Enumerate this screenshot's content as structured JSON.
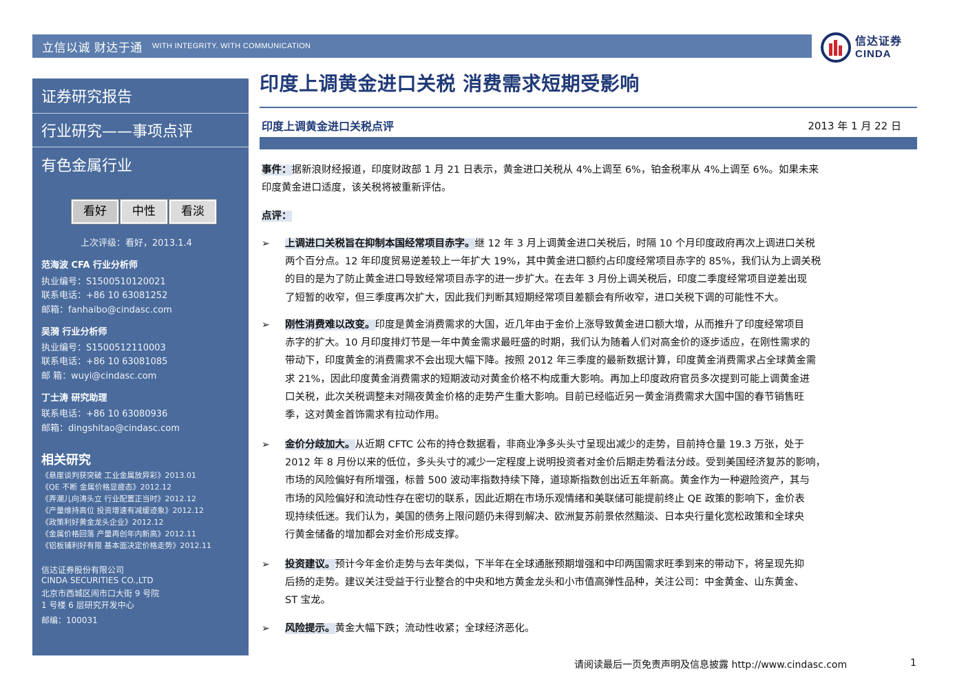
{
  "header": {
    "slogan_cn": "立信以诚  财达于通",
    "slogan_en": "WITH INTEGRITY. WITH COMMUNICATION",
    "logo_cn": "信达证券",
    "logo_en": "CINDA"
  },
  "sidebar": {
    "heads": [
      "证券研究报告",
      "行业研究——事项点评",
      "有色金属行业"
    ],
    "ratings": [
      "看好",
      "中性",
      "看淡"
    ],
    "last_rating": "上次评级：看好，2013.1.4",
    "analysts": [
      {
        "name": "范海波 CFA   行业分析师",
        "lines": [
          "执业编号：S1500510120021",
          "联系电话：+86 10 63081252",
          "邮箱：fanhaibo@cindasc.com"
        ]
      },
      {
        "name": "吴漪   行业分析师",
        "lines": [
          "执业编号：S1500512110003",
          "联系电话：+86 10 63081085",
          "邮    箱：wuyi@cindasc.com"
        ]
      },
      {
        "name": "丁士涛  研究助理",
        "lines": [
          "联系电话：+86 10 63080936",
          "邮箱：dingshitao@cindasc.com"
        ]
      }
    ],
    "related_title": "相关研究",
    "related": [
      "《悬崖谈判获突破 工业金属放异彩》2013.01",
      "《QE 不断 金属价格显疲态》2012.12",
      "《弄潮儿向涛头立 行业配置正当时》2012.12",
      "《产量维持高位 投资增速有减缓迹象》2012.12",
      "《政策利好黄金龙头企业》2012.12",
      "《金属价格回落 产量再创年内新高》2012.11",
      "《铝板铺利好有限 基本面决定价格走势》2012.11"
    ],
    "company": [
      "信达证券股份有限公司",
      "CINDA SECURITIES CO.,LTD",
      "北京市西城区闹市口大街 9 号院",
      "1 号楼 6 层研究开发中心",
      "邮编：100031"
    ]
  },
  "main": {
    "title": "印度上调黄金进口关税  消费需求短期受影响",
    "subtitle": "印度上调黄金进口关税点评",
    "date": "2013 年 1 月 22 日",
    "event_label": "事件：",
    "event_lines": [
      "据新浪财经报道，印度财政部 1 月 21 日表示，黄金进口关税从 4%上调至 6%，铂金税率从 4%上调至 6%。如果未来",
      "印度黄金进口适度，该关税将被重新评估。"
    ],
    "review_label": "点评：",
    "bullet_glyph": "➢",
    "bullets": [
      {
        "title": "上调进口关税旨在抑制本国经常项目赤字。",
        "lines": [
          "继 12 年 3 月上调黄金进口关税后，时隔 10 个月印度政府再次上调进口关税",
          "两个百分点。12 年印度贸易逆差较上一年扩大 19%，其中黄金进口额约占印度经常项目赤字的 85%，我们认为上调关税",
          "的目的是为了防止黄金进口导致经常项目赤字的进一步扩大。在去年 3 月份上调关税后，印度二季度经常项目逆差出现",
          "了短暂的收窄，但三季度再次扩大，因此我们判断其短期经常项目差额会有所收窄，进口关税下调的可能性不大。"
        ]
      },
      {
        "title": "刚性消费难以改变。",
        "lines": [
          "印度是黄金消费需求的大国，近几年由于金价上涨导致黄金进口额大增，从而推升了印度经常项目",
          "赤字的扩大。10 月印度排灯节是一年中黄金需求最旺盛的时期，我们认为随着人们对高金价的逐步适应，在刚性需求的",
          "带动下，印度黄金的消费需求不会出现大幅下降。按照 2012 年三季度的最新数据计算，印度黄金消费需求占全球黄金需",
          "求 21%，因此印度黄金消费需求的短期波动对黄金价格不构成重大影响。再加上印度政府官员多次提到可能上调黄金进",
          "口关税，此次关税调整未对隔夜黄金价格的走势产生重大影响。目前已经临近另一黄金消费需求大国中国的春节销售旺",
          "季，这对黄金首饰需求有拉动作用。"
        ]
      },
      {
        "title": "金价分歧加大。",
        "lines": [
          "从近期 CFTC 公布的持仓数据看，非商业净多头头寸呈现出减少的走势，目前持仓量 19.3 万张，处于",
          "2012 年 8 月份以来的低位，多头头寸的减少一定程度上说明投资者对金价后期走势看法分歧。受到美国经济复苏的影响，",
          "市场的风险偏好有所增强，标普 500 波动率指数持续下降，道琼斯指数创出近五年新高。黄金作为一种避险资产，其与",
          "市场的风险偏好和流动性存在密切的联系，因此近期在市场乐观情绪和美联储可能提前终止 QE 政策的影响下，金价表",
          "现持续低迷。我们认为，美国的债务上限问题仍未得到解决、欧洲复苏前景依然黯淡、日本央行量化宽松政策和全球央",
          "行黄金储备的增加都会对金价形成支撑。"
        ]
      },
      {
        "title": "投资建议。",
        "lines": [
          "预计今年金价走势与去年类似，下半年在全球通胀预期增强和中印两国需求旺季到来的带动下，将呈现先抑",
          "后扬的走势。建议关注受益于行业整合的中央和地方黄金龙头和小市值高弹性品种，关注公司：中金黄金、山东黄金、",
          "ST 宝龙。"
        ]
      },
      {
        "title": "风险提示。",
        "lines": [
          "黄金大幅下跌；流动性收紧；全球经济恶化。"
        ]
      }
    ]
  },
  "footer": {
    "disclaimer": "请阅读最后一页免责声明及信息披露 http://www.cindasc.com",
    "page": "1"
  }
}
